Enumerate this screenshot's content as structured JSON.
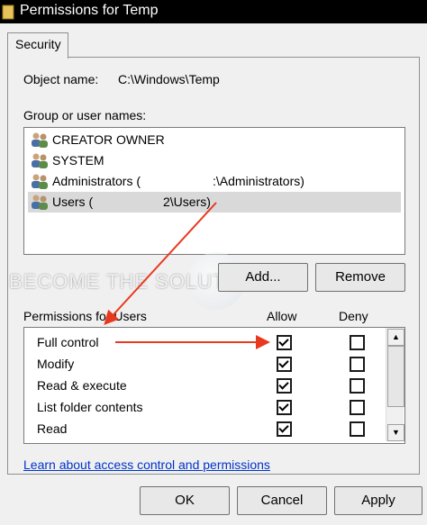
{
  "window": {
    "title": "Permissions for Temp"
  },
  "tabs": [
    {
      "label": "Security"
    }
  ],
  "object": {
    "label": "Object name:",
    "value": "C:\\Windows\\Temp"
  },
  "groups": {
    "label": "Group or user names:",
    "users": [
      {
        "name": "CREATOR OWNER"
      },
      {
        "name": "SYSTEM"
      },
      {
        "name": "Administrators (",
        "suffix": ":\\Administrators)"
      },
      {
        "name": "Users (",
        "suffix": "2\\Users)",
        "selected": true
      }
    ]
  },
  "buttons": {
    "add": "Add...",
    "remove": "Remove",
    "ok": "OK",
    "cancel": "Cancel",
    "apply": "Apply"
  },
  "permissions": {
    "label": "Permissions for Users",
    "allow_label": "Allow",
    "deny_label": "Deny",
    "items": [
      {
        "name": "Full control",
        "allow": true,
        "deny": false
      },
      {
        "name": "Modify",
        "allow": true,
        "deny": false
      },
      {
        "name": "Read & execute",
        "allow": true,
        "deny": false
      },
      {
        "name": "List folder contents",
        "allow": true,
        "deny": false
      },
      {
        "name": "Read",
        "allow": true,
        "deny": false
      }
    ]
  },
  "link": {
    "text": "Learn about access control and permissions"
  },
  "watermark": {
    "text": "BECOME THE SOLUTION"
  },
  "colors": {
    "annotation": "#e8391f",
    "link": "#0033cc",
    "selection": "#d9d9d9"
  }
}
